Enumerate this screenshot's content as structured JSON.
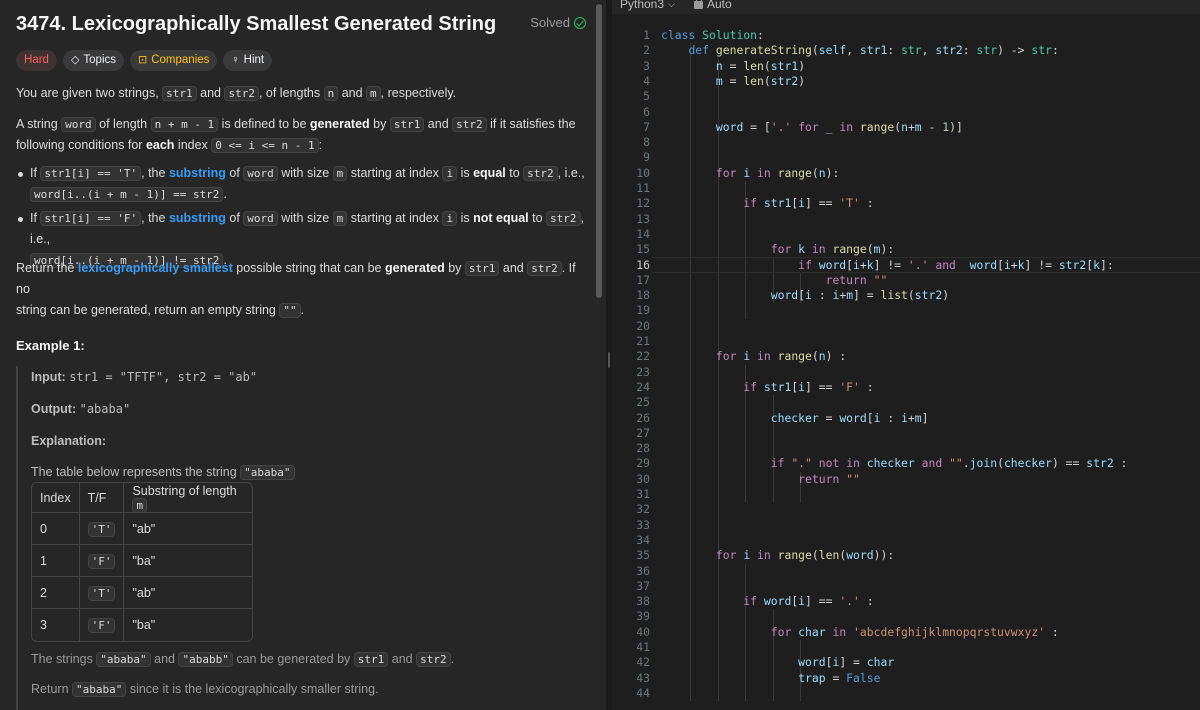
{
  "problem": {
    "title": "3474. Lexicographically Smallest Generated String",
    "solved_label": "Solved",
    "tags": {
      "difficulty": "Hard",
      "topics": "Topics",
      "companies": "Companies",
      "hint": "Hint"
    },
    "p1": {
      "a": "You are given two strings, ",
      "c1": "str1",
      "b": " and ",
      "c2": "str2",
      "c": ", of lengths ",
      "c3": "n",
      "d": " and ",
      "c4": "m",
      "e": ", respectively."
    },
    "p2": {
      "a": "A string ",
      "c1": "word",
      "b": " of length ",
      "c2": "n + m - 1",
      "c": " is defined to be ",
      "b1": "generated",
      "d": " by ",
      "c3": "str1",
      "e": " and ",
      "c4": "str2",
      "f": " if it satisfies the",
      "g": "following conditions for ",
      "b2": "each",
      "h": " index ",
      "c5": "0 <= i <= n - 1",
      "i": ":"
    },
    "bullet1": {
      "a": "If ",
      "c1": "str1[i] == 'T'",
      "b": ", the ",
      "link": "substring",
      "c": " of ",
      "c2": "word",
      "d": " with size ",
      "c3": "m",
      "e": " starting at index ",
      "c4": "i",
      "f": " is ",
      "b1": "equal",
      "g": " to ",
      "c5": "str2",
      "h": ", i.e.,",
      "c6": "word[i..(i + m - 1)] == str2",
      "i": "."
    },
    "bullet2": {
      "a": "If ",
      "c1": "str1[i] == 'F'",
      "b": ", the ",
      "link": "substring",
      "c": " of ",
      "c2": "word",
      "d": " with size ",
      "c3": "m",
      "e": " starting at index ",
      "c4": "i",
      "f": " is ",
      "b1": "not equal",
      "g": " to ",
      "c5": "str2",
      "h": ", i.e.,",
      "c6": "word[i..(i + m - 1)] != str2",
      "i": "."
    },
    "p3": {
      "a": "Return the ",
      "link": "lexicographically smallest",
      "b": " possible string that can be ",
      "b1": "generated",
      "c": " by ",
      "c1": "str1",
      "d": " and ",
      "c2": "str2",
      "e": ". If no",
      "f": "string can be generated, return an empty string ",
      "c3": "\"\"",
      "g": "."
    },
    "example": {
      "heading": "Example 1:",
      "input_label": "Input:",
      "input_value": "str1 = \"TFTF\", str2 = \"ab\"",
      "output_label": "Output:",
      "output_value": "\"ababa\"",
      "explanation_label": "Explanation:",
      "table_intro": "The table below represents the string ",
      "table_intro_code": "\"ababa\"",
      "table_headers": [
        "Index",
        "T/F",
        "Substring of length "
      ],
      "table_header_code": "m",
      "rows": [
        {
          "index": "0",
          "tf": "'T'",
          "sub": "\"ab\""
        },
        {
          "index": "1",
          "tf": "'F'",
          "sub": "\"ba\""
        },
        {
          "index": "2",
          "tf": "'T'",
          "sub": "\"ab\""
        },
        {
          "index": "3",
          "tf": "'F'",
          "sub": "\"ba\""
        }
      ],
      "note1": {
        "a": "The strings ",
        "c1": "\"ababa\"",
        "b": " and ",
        "c2": "\"ababb\"",
        "c": " can be generated by ",
        "c3": "str1",
        "d": " and ",
        "c4": "str2",
        "e": "."
      },
      "note2": {
        "a": "Return ",
        "c1": "\"ababa\"",
        "b": " since it is the lexicographically smaller string."
      }
    }
  },
  "editor": {
    "language": "Python3",
    "mode": "Auto",
    "active_line": 16,
    "line_count": 44,
    "lines": [
      "class Solution:",
      "    def generateString(self, str1: str, str2: str) -> str:",
      "        n = len(str1)",
      "        m = len(str2)",
      "",
      "",
      "        word = ['.' for _ in range(n+m - 1)]",
      "",
      "",
      "        for i in range(n):",
      "",
      "            if str1[i] == 'T' :",
      "",
      "",
      "                for k in range(m):",
      "                    if word[i+k] != '.' and  word[i+k] != str2[k]:",
      "                        return \"\"",
      "                word[i : i+m] = list(str2)",
      "",
      "",
      "",
      "        for i in range(n) :",
      "",
      "            if str1[i] == 'F' :",
      "",
      "                checker = word[i : i+m]",
      "",
      "",
      "                if \".\" not in checker and \"\".join(checker) == str2 :",
      "                    return \"\"",
      "",
      "",
      "",
      "",
      "        for i in range(len(word)):",
      "",
      "",
      "            if word[i] == '.' :",
      "",
      "                for char in 'abcdefghijklmnopqrstuvwxyz' :",
      "",
      "                    word[i] = char",
      "                    trap = False",
      ""
    ]
  }
}
